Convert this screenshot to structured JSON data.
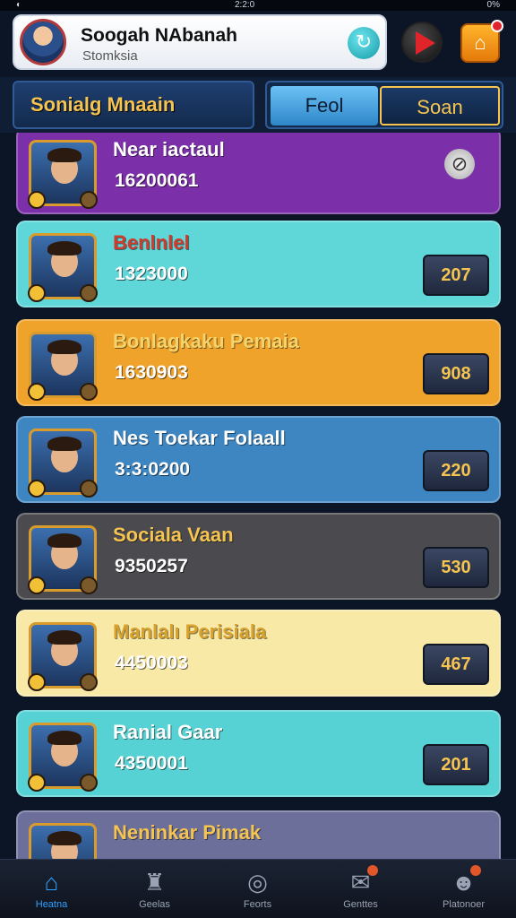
{
  "status_bar": {
    "left": "◐",
    "time": "2:2:0",
    "right": "0%"
  },
  "profile": {
    "name": "Soogah NAbanah",
    "subtitle": "Stomksia"
  },
  "toolbar": {
    "filter_label": "Sonialg Mnaain",
    "tabs": [
      {
        "label": "Feol"
      },
      {
        "label": "Soan"
      }
    ]
  },
  "rows": [
    {
      "name": "Near iactaul",
      "score": "16200061",
      "action": "",
      "bg": "#7b2fa8",
      "name_color": "#ffffff"
    },
    {
      "name": "Benlnlel",
      "score": "1323000",
      "action": "207",
      "bg": "#5fd6d8",
      "name_color": "#d33a2c"
    },
    {
      "name": "Bonlagkaku Pemaia",
      "score": "1630903",
      "action": "908",
      "bg": "#f0a32a",
      "name_color": "#f5d36b"
    },
    {
      "name": "Nes Toekar Folaall",
      "score": "3:3:0200",
      "action": "220",
      "bg": "#3d86c2",
      "name_color": "#ffffff"
    },
    {
      "name": "Sociala Vaan",
      "score": "9350257",
      "action": "530",
      "bg": "#4b4b4f",
      "name_color": "#f5c451"
    },
    {
      "name": "Manlalı Perisiala",
      "score": "4450003",
      "action": "467",
      "bg": "#f8e9a6",
      "name_color": "#d9a22c"
    },
    {
      "name": "Ranial Gaar",
      "score": "4350001",
      "action": "201",
      "bg": "#57d2d4",
      "name_color": "#ffffff"
    },
    {
      "name": "Neninkar Pimak",
      "score": "",
      "action": "",
      "bg": "#6b6f9a",
      "name_color": "#f5c451"
    }
  ],
  "bottom_nav": [
    {
      "label": "Heatna",
      "icon": "home-icon"
    },
    {
      "label": "Geelas",
      "icon": "castle-icon"
    },
    {
      "label": "Feorts",
      "icon": "target-icon"
    },
    {
      "label": "Genttes",
      "icon": "mail-icon"
    },
    {
      "label": "Platonoer",
      "icon": "profile-icon"
    }
  ],
  "colors": {
    "accent": "#f5c451",
    "nav_active": "#2fa0ff",
    "background": "#0b1526"
  }
}
